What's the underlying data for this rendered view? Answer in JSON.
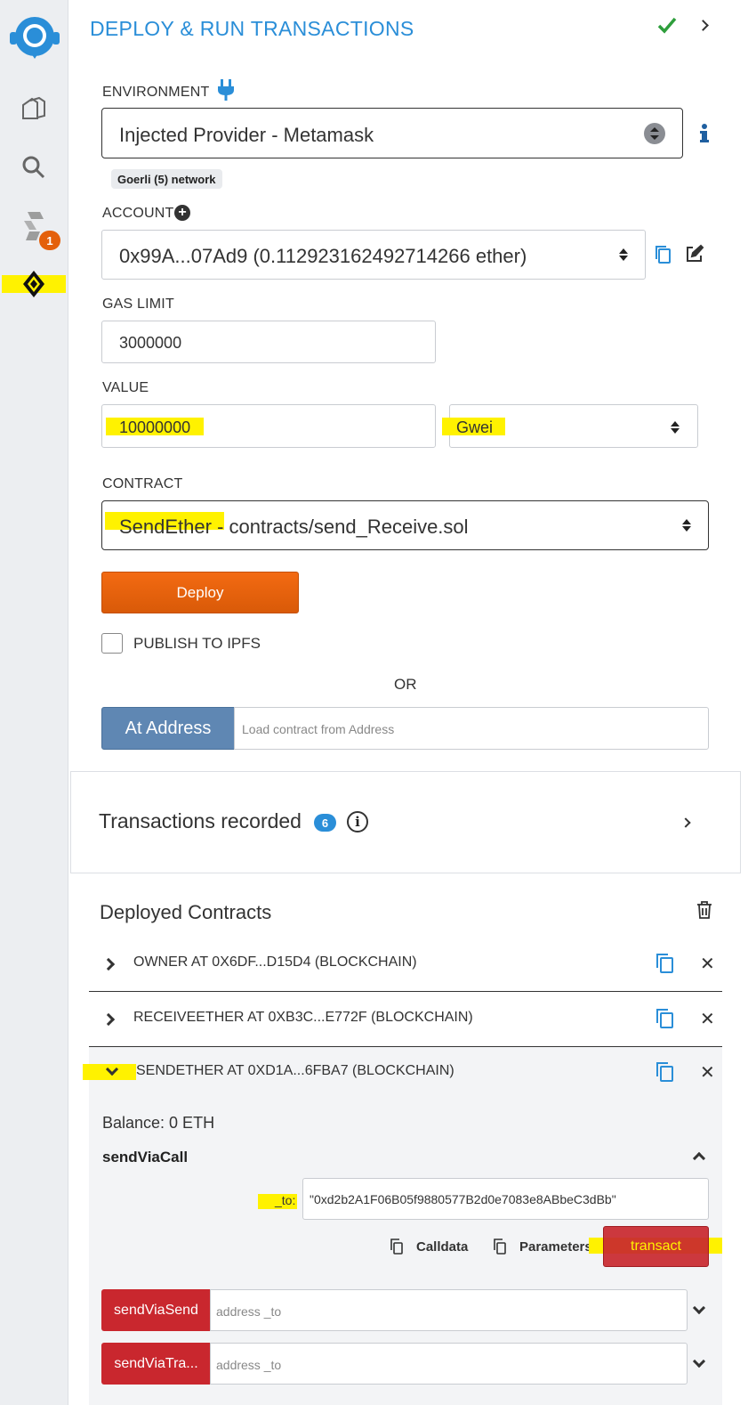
{
  "header": {
    "title": "DEPLOY & RUN TRANSACTIONS"
  },
  "sidebar": {
    "badge_count": "1"
  },
  "environment": {
    "label": "ENVIRONMENT",
    "value": "Injected Provider - Metamask",
    "network_badge": "Goerli (5) network"
  },
  "account": {
    "label": "ACCOUNT",
    "value": "0x99A...07Ad9 (0.112923162492714266 ether)"
  },
  "gas_limit": {
    "label": "GAS LIMIT",
    "value": "3000000"
  },
  "value": {
    "label": "VALUE",
    "amount": "10000000",
    "unit": "Gwei"
  },
  "contract": {
    "label": "CONTRACT",
    "name": "SendEther",
    "path": " - contracts/send_Receive.sol"
  },
  "deploy": {
    "label": "Deploy"
  },
  "publish": {
    "label": "PUBLISH TO IPFS"
  },
  "or_label": "OR",
  "at_address": {
    "label": "At Address",
    "placeholder": "Load contract from Address"
  },
  "transactions": {
    "label": "Transactions recorded",
    "count": "6"
  },
  "deployed": {
    "title": "Deployed Contracts",
    "contracts": [
      {
        "name": "OWNER AT 0X6DF...D15D4 (BLOCKCHAIN)"
      },
      {
        "name": "RECEIVEETHER AT 0XB3C...E772F (BLOCKCHAIN)"
      },
      {
        "name": "SENDETHER AT 0XD1A...6FBA7 (BLOCKCHAIN)"
      }
    ],
    "balance": "Balance: 0 ETH",
    "function": {
      "name": "sendViaCall",
      "param_label": "_to:",
      "param_value": "\"0xd2b2A1F06B05f9880577B2d0e7083e8ABbeC3dBb\"",
      "calldata_label": "Calldata",
      "parameters_label": "Parameters",
      "transact_label": "transact"
    },
    "functions": [
      {
        "label": "sendViaSend",
        "placeholder": "address _to"
      },
      {
        "label": "sendViaTra...",
        "placeholder": "address _to"
      }
    ]
  },
  "colors": {
    "accent": "#2a8ed8",
    "deploy": "#e4600b",
    "transact": "#c9272e",
    "highlight": "#fff200"
  }
}
